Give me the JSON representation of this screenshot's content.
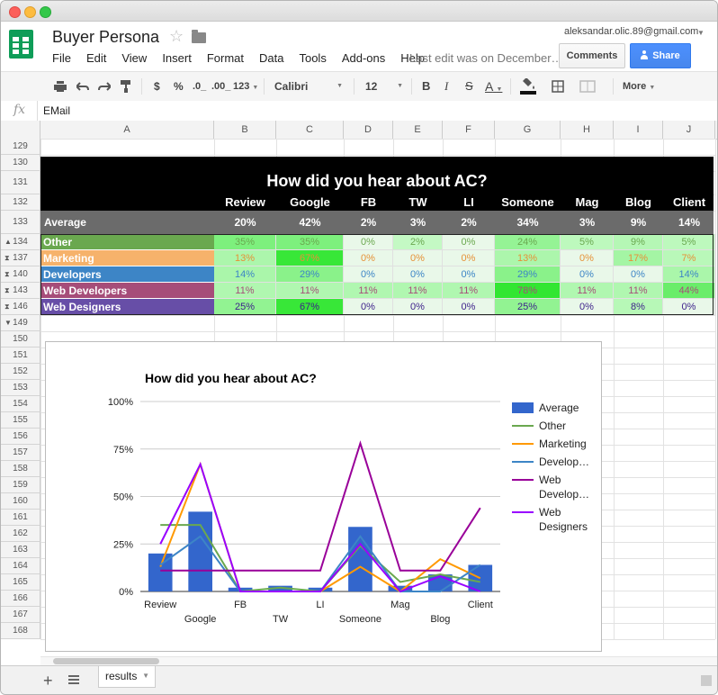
{
  "app": {
    "doc_title": "Buyer Persona",
    "menu": [
      "File",
      "Edit",
      "View",
      "Insert",
      "Format",
      "Data",
      "Tools",
      "Add-ons",
      "Help"
    ],
    "last_edit": "Last edit was on December…",
    "account": "aleksandar.olic.89@gmail.com",
    "comments_label": "Comments",
    "share_label": "Share",
    "brand_color": "#0f9d58",
    "share_color": "#4787ed"
  },
  "toolbar": {
    "currency": "$",
    "percent": "%",
    "dec_less": ".0_",
    "dec_more": ".00_",
    "number_format": "123",
    "font": "Calibri",
    "font_size": "12",
    "bold": "B",
    "italic": "I",
    "strike": "S",
    "text_color": "A",
    "more": "More",
    "icons": [
      "print-icon",
      "undo-icon",
      "redo-icon",
      "paint-format-icon",
      "fill-color-icon",
      "borders-icon",
      "merge-icon"
    ]
  },
  "formula": {
    "fx": "fx",
    "value": "EMail"
  },
  "sheet": {
    "col_labels": [
      "A",
      "B",
      "C",
      "D",
      "E",
      "F",
      "G",
      "H",
      "I",
      "J"
    ],
    "row_numbers": [
      "129",
      "130",
      "131",
      "132",
      "133",
      "134",
      "137",
      "140",
      "143",
      "146",
      "149",
      "150",
      "151",
      "152",
      "153",
      "154",
      "155",
      "156",
      "157",
      "158",
      "159",
      "160",
      "161",
      "162",
      "163",
      "164",
      "165",
      "166",
      "167",
      "168"
    ],
    "title": "How did you hear about AC?",
    "headers": [
      "Review",
      "Google",
      "FB",
      "TW",
      "LI",
      "Someone",
      "Mag",
      "Blog",
      "Client"
    ],
    "average_label": "Average",
    "average_values": [
      "20%",
      "42%",
      "2%",
      "3%",
      "2%",
      "34%",
      "3%",
      "9%",
      "14%"
    ],
    "rows": [
      {
        "label": "Other",
        "color": "#6aa84f",
        "text_color": "#6aa84f",
        "values": [
          "35%",
          "35%",
          "0%",
          "2%",
          "0%",
          "24%",
          "5%",
          "9%",
          "5%"
        ]
      },
      {
        "label": "Marketing",
        "color": "#f6b26b",
        "text_color": "#e69138",
        "values": [
          "13%",
          "67%",
          "0%",
          "0%",
          "0%",
          "13%",
          "0%",
          "17%",
          "7%"
        ]
      },
      {
        "label": "Developers",
        "color": "#3d85c6",
        "text_color": "#3d85c6",
        "values": [
          "14%",
          "29%",
          "0%",
          "0%",
          "0%",
          "29%",
          "0%",
          "0%",
          "14%"
        ]
      },
      {
        "label": "Web Developers",
        "color": "#a64d79",
        "text_color": "#a64d79",
        "values": [
          "11%",
          "11%",
          "11%",
          "11%",
          "11%",
          "78%",
          "11%",
          "11%",
          "44%"
        ]
      },
      {
        "label": "Web Designers",
        "color": "#674ea7",
        "text_color": "#3c1f8a",
        "values": [
          "25%",
          "67%",
          "0%",
          "0%",
          "0%",
          "25%",
          "0%",
          "8%",
          "0%"
        ]
      }
    ],
    "tab_name": "results"
  },
  "chart_data": {
    "type": "bar",
    "title": "How did you hear about AC?",
    "categories": [
      "Review",
      "Google",
      "FB",
      "TW",
      "LI",
      "Someone",
      "Mag",
      "Blog",
      "Client"
    ],
    "ylim": [
      0,
      100
    ],
    "yticks": [
      "0%",
      "25%",
      "50%",
      "75%",
      "100%"
    ],
    "xlabel": "",
    "ylabel": "",
    "legend_position": "right",
    "series": [
      {
        "name": "Average",
        "kind": "bar",
        "color": "#3366cc",
        "values": [
          20,
          42,
          2,
          3,
          2,
          34,
          3,
          9,
          14
        ]
      },
      {
        "name": "Other",
        "kind": "line",
        "color": "#6aa84f",
        "values": [
          35,
          35,
          0,
          2,
          0,
          24,
          5,
          9,
          5
        ]
      },
      {
        "name": "Marketing",
        "kind": "line",
        "color": "#ff9900",
        "values": [
          13,
          67,
          0,
          0,
          0,
          13,
          0,
          17,
          7
        ]
      },
      {
        "name": "Develop…",
        "kind": "line",
        "color": "#3d85c6",
        "values": [
          14,
          29,
          0,
          0,
          0,
          29,
          0,
          0,
          14
        ]
      },
      {
        "name": "Web Develop…",
        "kind": "line",
        "color": "#990099",
        "values": [
          11,
          11,
          11,
          11,
          11,
          78,
          11,
          11,
          44
        ]
      },
      {
        "name": "Web Designers",
        "kind": "line",
        "color": "#9900ff",
        "values": [
          25,
          67,
          0,
          0,
          0,
          25,
          0,
          8,
          0
        ]
      }
    ]
  }
}
